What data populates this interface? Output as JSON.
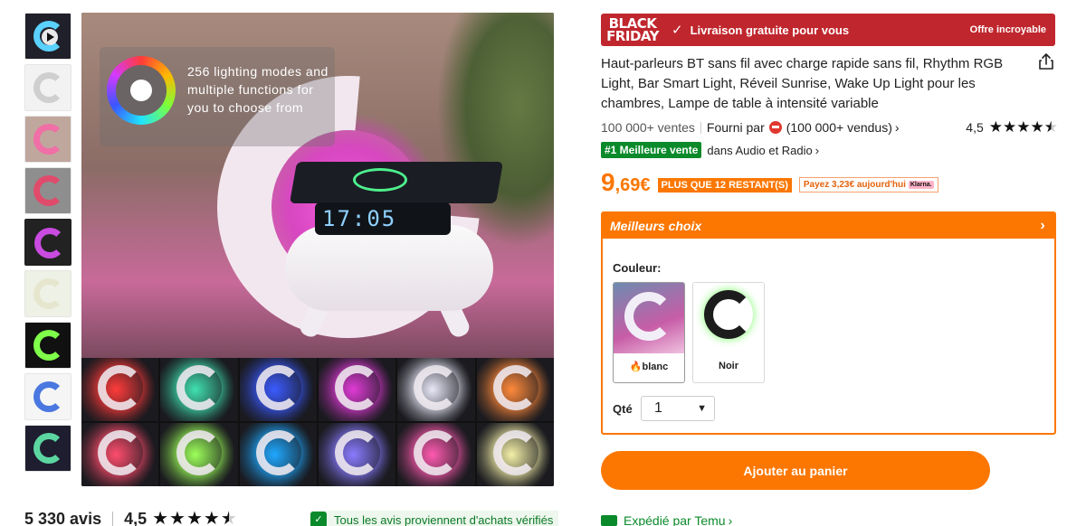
{
  "gallery": {
    "thumbnails": [
      {
        "name": "video",
        "bg": "#20202a",
        "ring": "#5ad1ff"
      },
      {
        "name": "dimensions",
        "bg": "#f2f2f2",
        "ring": "#cfcfcf"
      },
      {
        "name": "lifestyle-pink",
        "bg": "#c0a79d",
        "ring": "#f06fa6"
      },
      {
        "name": "phone",
        "bg": "#8e8e8e",
        "ring": "#e04b6c"
      },
      {
        "name": "collage",
        "bg": "#222",
        "ring": "#c94be0"
      },
      {
        "name": "white",
        "bg": "#eef1e5",
        "ring": "#f8f8ec"
      },
      {
        "name": "rgb",
        "bg": "#111",
        "ring": "#7fff4a"
      },
      {
        "name": "colors",
        "bg": "#f5f5f5",
        "ring": "#4a77e0"
      },
      {
        "name": "charging",
        "bg": "#1e1e30",
        "ring": "#5cd6a0"
      }
    ],
    "overlay_text": "256 lighting modes and multiple functions for you to choose from",
    "clock_text": "17:05",
    "grid_colors": [
      "#ff3b3b",
      "#40e0b0",
      "#3b5bff",
      "#e03bd6",
      "#e8e8f8",
      "#ff8a3b",
      "#ff4d6d",
      "#9cff5a",
      "#1fa8ff",
      "#8a7bff",
      "#ff5ab0",
      "#f4f0a8"
    ]
  },
  "reviews": {
    "count": "5 330 avis",
    "rating": "4,5",
    "verified_text": "Tous les avis proviennent d'achats vérifiés"
  },
  "banner": {
    "black_friday_line1": "BLACK",
    "black_friday_line2": "FRIDAY",
    "message": "Livraison gratuite pour vous",
    "offer": "Offre incroyable"
  },
  "product": {
    "title": "Haut-parleurs BT sans fil avec charge rapide sans fil, Rhythm RGB Light, Bar Smart Light, Réveil Sunrise, Wake Up Light pour les chambres, Lampe de table à intensité variable",
    "sales": "100 000+ ventes",
    "supplied_by": "Fourni par",
    "seller_sales": "(100 000+ vendus)",
    "rating": "4,5",
    "best_seller_badge": "#1 Meilleure vente",
    "best_seller_category": "dans Audio et Radio",
    "price_int": "9",
    "price_dec": ",69€",
    "stock_badge": "PLUS QUE 12 RESTANT(S)",
    "klarna_text": "Payez 3,23€ aujourd'hui",
    "klarna_logo": "Klarna."
  },
  "options": {
    "header": "Meilleurs choix",
    "color_label": "Couleur:",
    "colors": [
      {
        "name": "blanc",
        "hot": true
      },
      {
        "name": "Noir",
        "hot": false
      }
    ],
    "qty_label": "Qté",
    "qty_value": "1"
  },
  "actions": {
    "add_to_cart": "Ajouter au panier",
    "shipped_by": "Expédié par Temu"
  },
  "colors": {
    "accent": "#fb7701",
    "banner": "#c0262d",
    "green": "#0a8a2a"
  }
}
